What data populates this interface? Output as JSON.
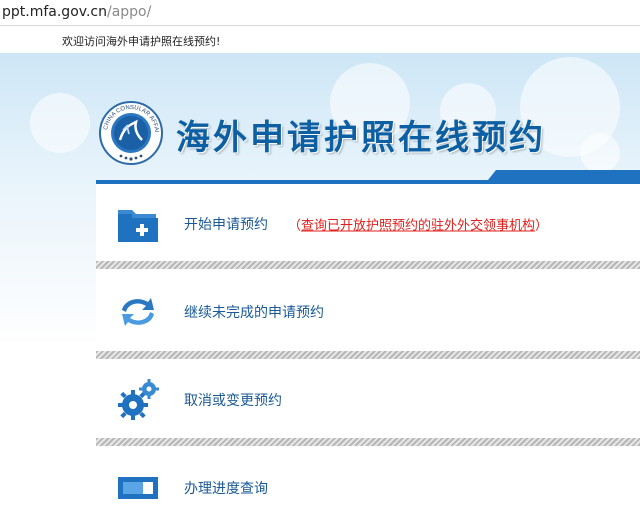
{
  "browser": {
    "url_host": "ppt.mfa.gov.cn",
    "url_path": "/appo/"
  },
  "header": {
    "welcome": "欢迎访问海外申请护照在线预约!"
  },
  "banner": {
    "title": "海外申请护照在线预约",
    "logo_text": "CHINA CONSULAR AFFAIRS"
  },
  "menu": {
    "items": [
      {
        "label": "开始申请预约",
        "note_prefix": "（",
        "note_link": "查询已开放护照预约的驻外外交领事机构",
        "note_suffix": "）"
      },
      {
        "label": "继续未完成的申请预约"
      },
      {
        "label": "取消或变更预约"
      },
      {
        "label": "办理进度查询"
      }
    ]
  },
  "colors": {
    "accent": "#1f72bf",
    "title": "#0d5fa3",
    "link_red": "#e0201c"
  }
}
